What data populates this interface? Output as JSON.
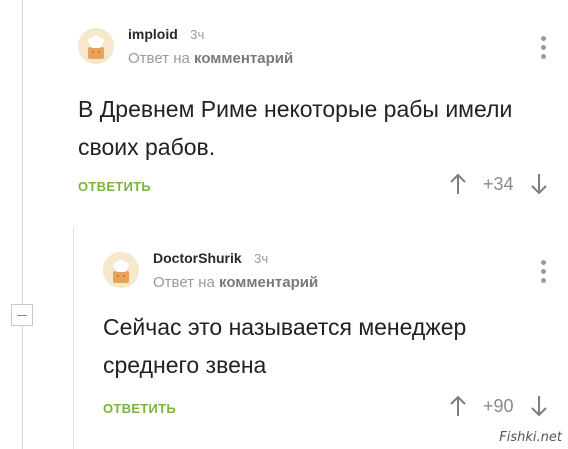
{
  "comments": [
    {
      "username": "imploid",
      "time": "3ч",
      "reply_prefix": "Ответ на",
      "reply_target": "комментарий",
      "text": "В Древнем Риме некоторые рабы имели своих рабов.",
      "reply_label": "ОТВЕТИТЬ",
      "votes": "+34"
    },
    {
      "username": "DoctorShurik",
      "time": "3ч",
      "reply_prefix": "Ответ на",
      "reply_target": "комментарий",
      "text": "Сейчас это называется менеджер среднего звена",
      "reply_label": "ОТВЕТИТЬ",
      "votes": "+90"
    }
  ],
  "icons": {
    "avatar": "default-chef-avatar-icon",
    "menu": "more-vertical-icon",
    "upvote": "arrow-up-icon",
    "downvote": "arrow-down-icon",
    "collapse": "minus-box-icon"
  },
  "colors": {
    "reply_link": "#7ab43c",
    "muted": "#9a9a9a"
  },
  "watermark": "Fishki.net"
}
